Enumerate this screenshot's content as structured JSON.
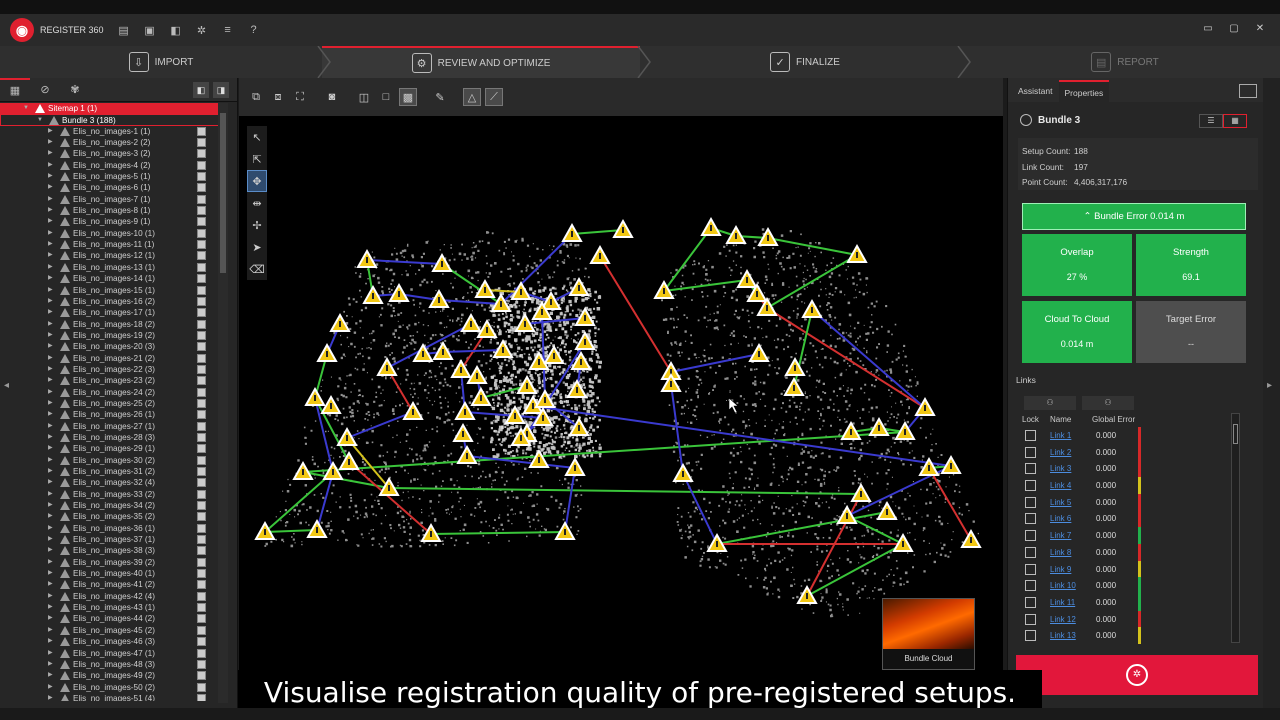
{
  "app": {
    "name": "REGISTER 360",
    "toolbar_icons": [
      "folder-open-icon",
      "save-icon",
      "project-icon",
      "gear-icon",
      "list-icon",
      "help-icon"
    ]
  },
  "workflow": {
    "steps": [
      {
        "label": "IMPORT",
        "icon": "import-icon",
        "state": "done"
      },
      {
        "label": "REVIEW AND OPTIMIZE",
        "icon": "review-icon",
        "state": "active"
      },
      {
        "label": "FINALIZE",
        "icon": "finalize-icon",
        "state": "normal"
      },
      {
        "label": "REPORT",
        "icon": "report-icon",
        "state": "disabled"
      }
    ]
  },
  "tree": {
    "sitemap": "Sitemap 1 (1)",
    "bundle": "Bundle 3 (188)",
    "items": [
      "Elis_no_images-1 (1)",
      "Elis_no_images-2 (2)",
      "Elis_no_images-3 (2)",
      "Elis_no_images-4 (2)",
      "Elis_no_images-5 (1)",
      "Elis_no_images-6 (1)",
      "Elis_no_images-7 (1)",
      "Elis_no_images-8 (1)",
      "Elis_no_images-9 (1)",
      "Elis_no_images-10 (1)",
      "Elis_no_images-11 (1)",
      "Elis_no_images-12 (1)",
      "Elis_no_images-13 (1)",
      "Elis_no_images-14 (1)",
      "Elis_no_images-15 (1)",
      "Elis_no_images-16 (2)",
      "Elis_no_images-17 (1)",
      "Elis_no_images-18 (2)",
      "Elis_no_images-19 (2)",
      "Elis_no_images-20 (3)",
      "Elis_no_images-21 (2)",
      "Elis_no_images-22 (3)",
      "Elis_no_images-23 (2)",
      "Elis_no_images-24 (2)",
      "Elis_no_images-25 (2)",
      "Elis_no_images-26 (1)",
      "Elis_no_images-27 (1)",
      "Elis_no_images-28 (3)",
      "Elis_no_images-29 (1)",
      "Elis_no_images-30 (2)",
      "Elis_no_images-31 (2)",
      "Elis_no_images-32 (4)",
      "Elis_no_images-33 (2)",
      "Elis_no_images-34 (2)",
      "Elis_no_images-35 (2)",
      "Elis_no_images-36 (1)",
      "Elis_no_images-37 (1)",
      "Elis_no_images-38 (3)",
      "Elis_no_images-39 (2)",
      "Elis_no_images-40 (1)",
      "Elis_no_images-41 (2)",
      "Elis_no_images-42 (4)",
      "Elis_no_images-43 (1)",
      "Elis_no_images-44 (2)",
      "Elis_no_images-45 (2)",
      "Elis_no_images-46 (3)",
      "Elis_no_images-47 (1)",
      "Elis_no_images-48 (3)",
      "Elis_no_images-49 (2)",
      "Elis_no_images-50 (2)",
      "Elis_no_images-51 (4)"
    ]
  },
  "right": {
    "tabs": [
      "Assistant",
      "Properties"
    ],
    "bundle_title": "Bundle 3",
    "stats": [
      {
        "label": "Setup Count:",
        "value": "188"
      },
      {
        "label": "Link Count:",
        "value": "197"
      },
      {
        "label": "Point Count:",
        "value": "4,406,317,176"
      }
    ],
    "bundle_error": "Bundle Error  0.014 m",
    "tiles": [
      {
        "title": "Overlap",
        "value": "27 %",
        "status": "good"
      },
      {
        "title": "Strength",
        "value": "69.1",
        "status": "good"
      },
      {
        "title": "Cloud To Cloud",
        "value": "0.014 m",
        "status": "good"
      },
      {
        "title": "Target Error",
        "value": "--",
        "status": "none"
      }
    ],
    "links_label": "Links",
    "links_headers": {
      "lock": "Lock",
      "name": "Name",
      "error": "Global Error"
    },
    "links": [
      {
        "name": "Link 1",
        "error": "0.000",
        "color": "#d62828"
      },
      {
        "name": "Link 2",
        "error": "0.000",
        "color": "#d62828"
      },
      {
        "name": "Link 3",
        "error": "0.000",
        "color": "#d62828"
      },
      {
        "name": "Link 4",
        "error": "0.000",
        "color": "#d4c21c"
      },
      {
        "name": "Link 5",
        "error": "0.000",
        "color": "#d62828"
      },
      {
        "name": "Link 6",
        "error": "0.000",
        "color": "#d62828"
      },
      {
        "name": "Link 7",
        "error": "0.000",
        "color": "#22b14c"
      },
      {
        "name": "Link 8",
        "error": "0.000",
        "color": "#d62828"
      },
      {
        "name": "Link 9",
        "error": "0.000",
        "color": "#d4c21c"
      },
      {
        "name": "Link 10",
        "error": "0.000",
        "color": "#22b14c"
      },
      {
        "name": "Link 11",
        "error": "0.000",
        "color": "#22b14c"
      },
      {
        "name": "Link 12",
        "error": "0.000",
        "color": "#d62828"
      },
      {
        "name": "Link 13",
        "error": "0.000",
        "color": "#d4c21c"
      }
    ]
  },
  "viewer": {
    "thumbnail_caption": "Bundle Cloud"
  },
  "caption": "Visualise registration quality of pre-registered setups."
}
